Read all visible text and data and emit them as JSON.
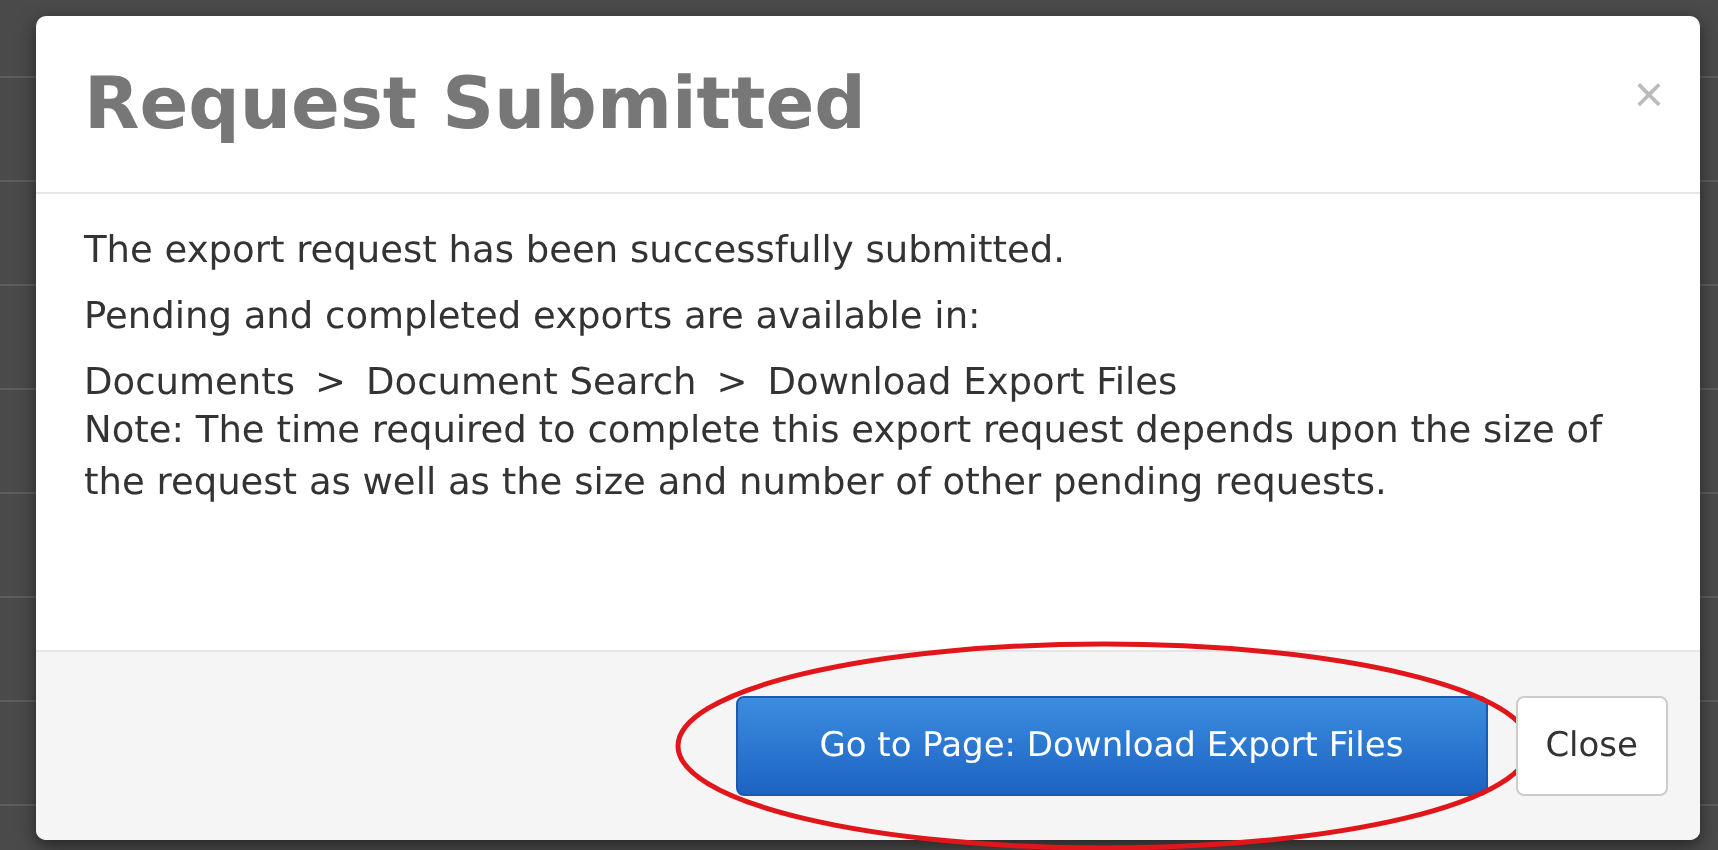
{
  "dialog": {
    "title": "Request Submitted",
    "close_icon": "×",
    "body": [
      "The export request has been successfully submitted.",
      "Pending and completed exports are available in:"
    ],
    "path": [
      "Documents",
      "Document Search",
      "Download Export Files"
    ],
    "path_separator": ">",
    "note": "Note: The time required to complete this export request depends upon the size of the request as well as the size and number of other pending requests.",
    "buttons": [
      {
        "label": "Go to Page: Download Export Files",
        "kind": "primary",
        "highlighted": true
      },
      {
        "label": "Close",
        "kind": "default",
        "highlighted": false
      }
    ]
  }
}
